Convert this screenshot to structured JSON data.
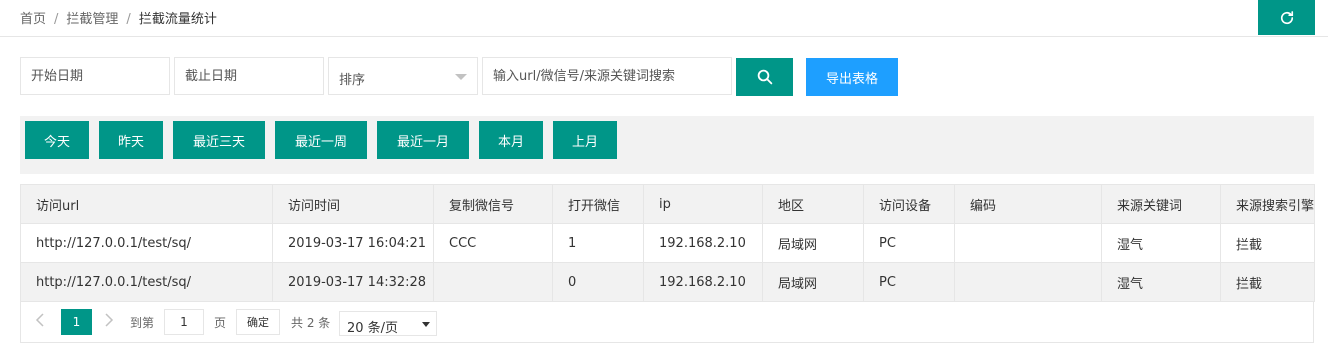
{
  "breadcrumb": {
    "items": [
      "首页",
      "拦截管理",
      "拦截流量统计"
    ],
    "separator": "/"
  },
  "toolbar": {
    "refresh_icon": "refresh-icon",
    "start_date_placeholder": "开始日期",
    "end_date_placeholder": "截止日期",
    "sort_value": "排序",
    "search_placeholder": "输入url/微信号/来源关键词搜索",
    "search_icon": "search-icon",
    "export_label": "导出表格"
  },
  "quick_ranges": [
    "今天",
    "昨天",
    "最近三天",
    "最近一周",
    "最近一月",
    "本月",
    "上月"
  ],
  "table": {
    "columns": [
      "访问url",
      "访问时间",
      "复制微信号",
      "打开微信",
      "ip",
      "地区",
      "访问设备",
      "编码",
      "来源关键词",
      "来源搜索引擎"
    ],
    "rows": [
      [
        "http://127.0.0.1/test/sq/",
        "2019-03-17 16:04:21",
        "CCC",
        "1",
        "192.168.2.10",
        "局域网",
        "PC",
        "",
        "湿气",
        "拦截"
      ],
      [
        "http://127.0.0.1/test/sq/",
        "2019-03-17 14:32:28",
        "",
        "0",
        "192.168.2.10",
        "局域网",
        "PC",
        "",
        "湿气",
        "拦截"
      ]
    ]
  },
  "pagination": {
    "current_page": "1",
    "goto_label": "到第",
    "goto_value": "1",
    "page_unit": "页",
    "confirm_label": "确定",
    "total_label": "共 2 条",
    "page_size": "20 条/页"
  },
  "colors": {
    "primary": "#009688",
    "export": "#1e9fff",
    "panel": "#f2f2f2",
    "border": "#e6e6e6"
  }
}
